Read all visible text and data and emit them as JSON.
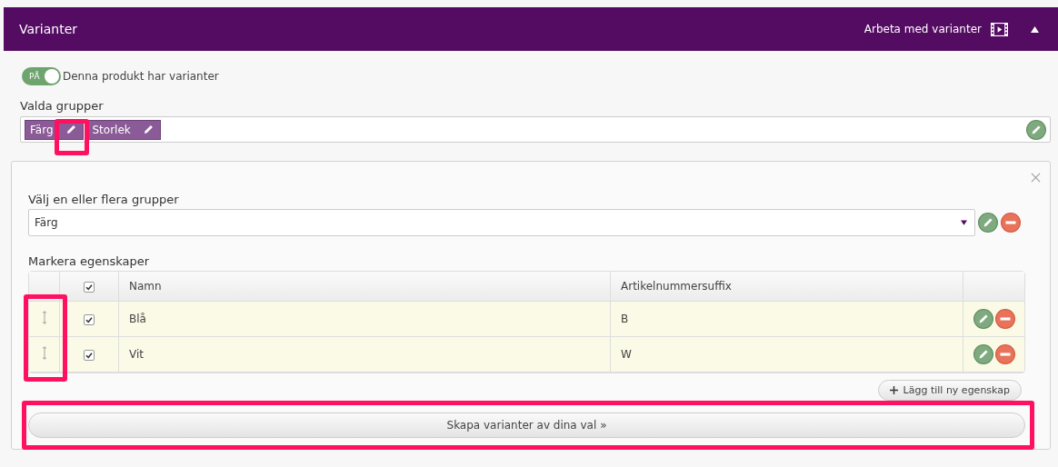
{
  "header": {
    "title": "Varianter",
    "action_label": "Arbeta med varianter",
    "expanded": true
  },
  "toggle": {
    "label": "PÅ",
    "on": true,
    "text": "Denna produkt har varianter"
  },
  "selected_groups": {
    "label": "Valda grupper",
    "tags": [
      "Färg",
      "Storlek"
    ]
  },
  "group_picker": {
    "label": "Välj en eller flera grupper",
    "value": "Färg"
  },
  "properties": {
    "label": "Markera egenskaper",
    "all_checked": true,
    "columns": [
      "Namn",
      "Artikelnummersuffix"
    ],
    "rows": [
      {
        "name": "Blå",
        "suffix": "B",
        "checked": true
      },
      {
        "name": "Vit",
        "suffix": "W",
        "checked": true
      }
    ]
  },
  "add_button": "Lägg till ny egenskap",
  "create_button": "Skapa varianter av dina val »"
}
